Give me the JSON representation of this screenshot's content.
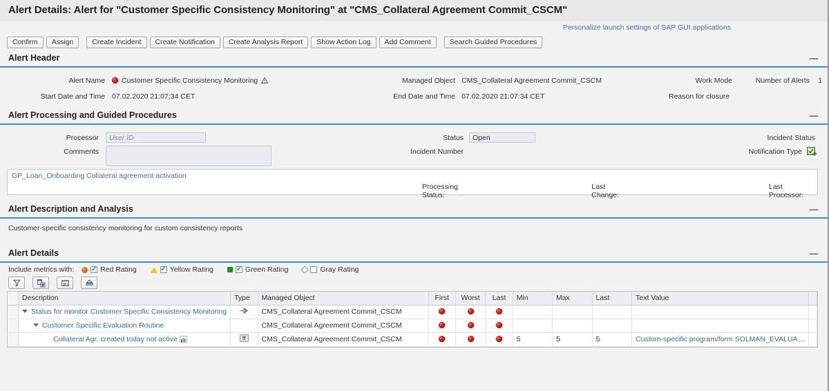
{
  "window": {
    "title": "Alert Details: Alert for \"Customer Specific Consistency Monitoring\" at \"CMS_Collateral Agreement Commit_CSCM\""
  },
  "personalize_link": "Personalize launch settings of SAP GUI applications",
  "toolbar": {
    "buttons": [
      "Confirm",
      "Assign",
      "Create Incident",
      "Create Notification",
      "Create Analysis Report",
      "Show Action Log",
      "Add Comment",
      "Search Guided Procedures"
    ]
  },
  "collapse_glyph": "—",
  "sections": {
    "alert_header": {
      "title": "Alert Header",
      "alert_name_label": "Alert Name",
      "alert_name_value": "Customer Specific Consistency Monitoring",
      "managed_object_label": "Managed Object",
      "managed_object_value": "CMS_Collateral Agreement Commit_CSCM",
      "work_mode_label": "Work Mode",
      "work_mode_value": "",
      "number_of_alerts_label": "Number of Alerts",
      "number_of_alerts_value": "1",
      "start_date_label": "Start Date and Time",
      "start_date_value": "07.02.2020 21:07:34 CET",
      "end_date_label": "End Date and Time",
      "end_date_value": "07.02.2020 21:07:34 CET",
      "reason_for_closure_label": "Reason for closure",
      "reason_for_closure_value": ""
    },
    "alert_processing": {
      "title": "Alert Processing and Guided Procedures",
      "processor_label": "Processor",
      "processor_placeholder": "User ID",
      "processor_value": "",
      "comments_label": "Comments",
      "comments_value": "",
      "status_label": "Status",
      "status_value": "Open",
      "incident_number_label": "Incident Number",
      "incident_number_value": "",
      "incident_status_label": "Incident Status",
      "incident_status_value": "",
      "notification_type_label": "Notification Type",
      "guided_procedure_link": "GP_Loan_Onboarding Collateral agreement activation",
      "processing_status_label": "Processing Status:",
      "last_change_label": "Last Change:",
      "last_processor_label": "Last Processor:"
    },
    "alert_description": {
      "title": "Alert Description and Analysis",
      "text": "Customer-specific consistency monitoring for custom consistency reports"
    },
    "alert_details": {
      "title": "Alert Details",
      "include_metrics_label": "Include metrics with:",
      "ratings": [
        {
          "label": "Red Rating",
          "checked": true,
          "shape": "red-ball",
          "color": "#d4601f"
        },
        {
          "label": "Yellow Rating",
          "checked": true,
          "shape": "yellow-triangle",
          "color": "#f5c518"
        },
        {
          "label": "Green Rating",
          "checked": true,
          "shape": "green-square",
          "color": "#1e8f1e"
        },
        {
          "label": "Gray Rating",
          "checked": false,
          "shape": "gray-diamond",
          "color": "#ffffff"
        }
      ],
      "icon_buttons": [
        "filter-icon",
        "insert-row-icon",
        "collapse-all-icon",
        "export-icon"
      ],
      "table": {
        "columns": [
          "Description",
          "Type",
          "Managed Object",
          "First",
          "Worst",
          "Last",
          "Min",
          "Max",
          "Last",
          "Text Value"
        ],
        "rows": [
          {
            "indent": 0,
            "expander": true,
            "description": "Status for monitor Customer Specific Consistency Monitoring",
            "type_icon": "monitor-node-icon",
            "managed_object": "CMS_Collateral Agreement Commit_CSCM",
            "first": "red",
            "worst": "red",
            "last_rating": "red",
            "min": "",
            "max": "",
            "last": "",
            "text_value": "",
            "chart_icon": false
          },
          {
            "indent": 1,
            "expander": true,
            "description": "Customer Specific Evaluation Routine",
            "type_icon": "",
            "managed_object": "CMS_Collateral Agreement Commit_CSCM",
            "first": "red",
            "worst": "red",
            "last_rating": "red",
            "min": "",
            "max": "",
            "last": "",
            "text_value": "",
            "chart_icon": false
          },
          {
            "indent": 2,
            "expander": false,
            "description": "Collateral Agr. created today not active",
            "type_icon": "metric-icon",
            "managed_object": "CMS_Collateral Agreement Commit_CSCM",
            "first": "red",
            "worst": "red",
            "last_rating": "red",
            "min": "5",
            "max": "5",
            "last": "5",
            "text_value": "Custom-specific program/form SOLMAN_EVALUA…",
            "chart_icon": true
          }
        ]
      }
    }
  }
}
